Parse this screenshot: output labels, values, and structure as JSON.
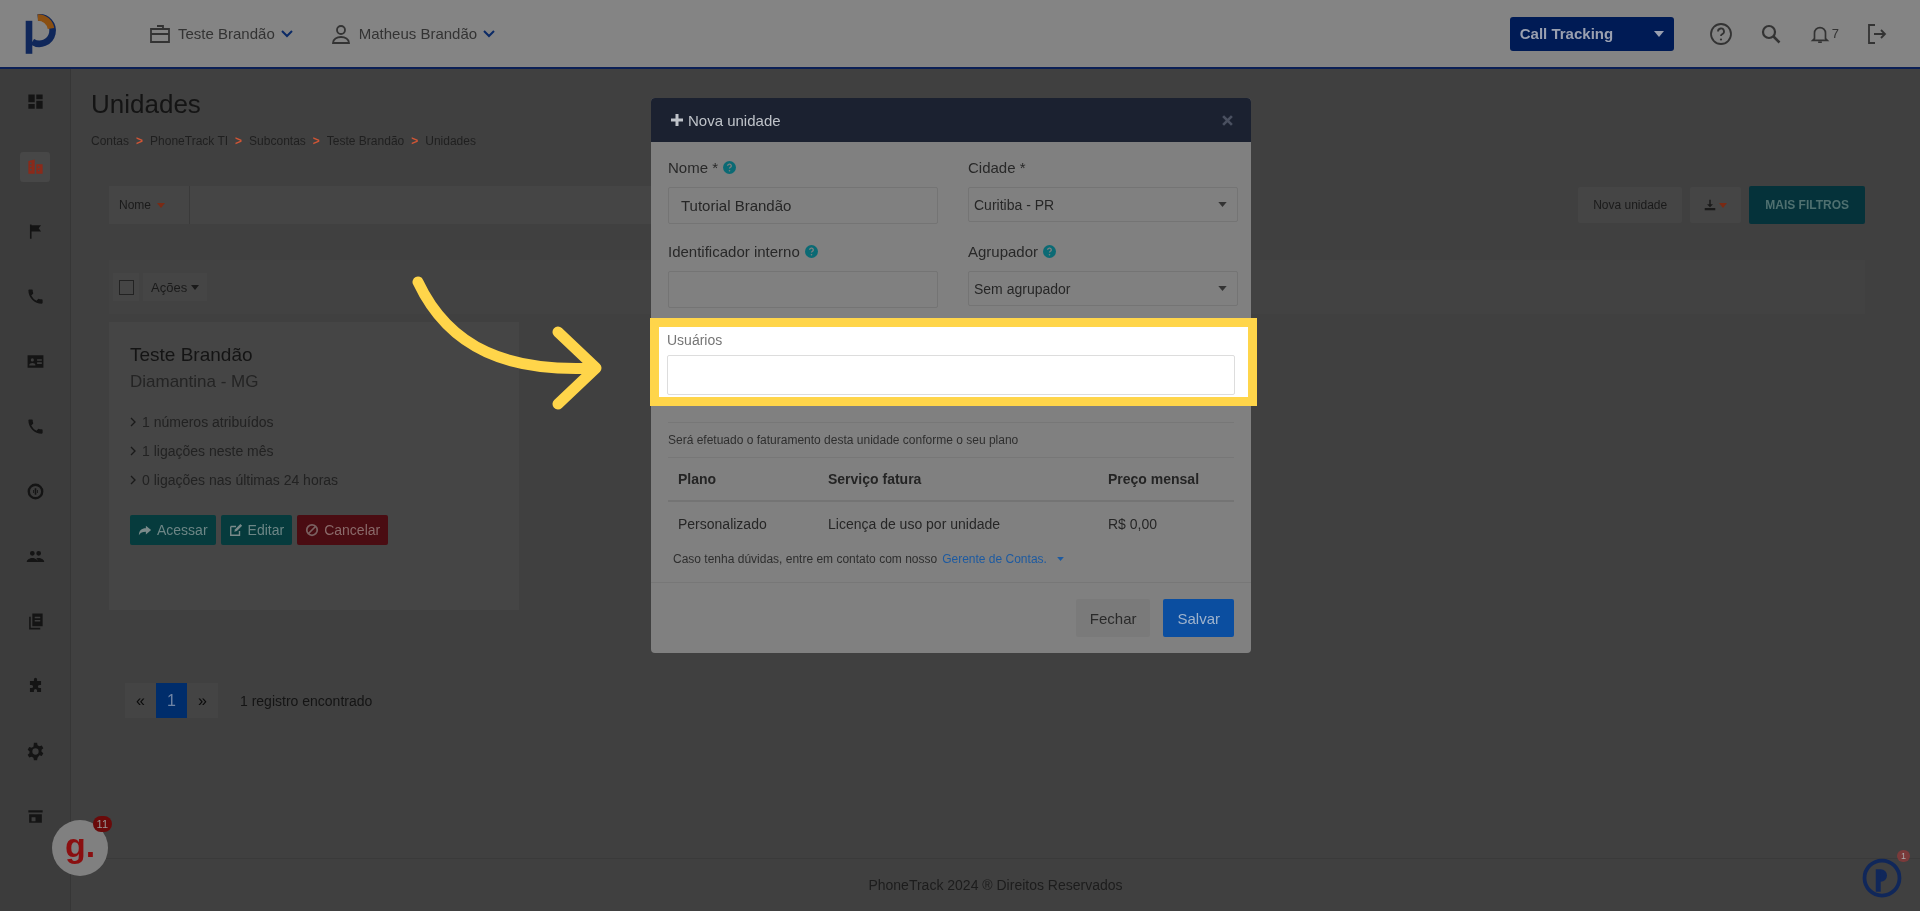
{
  "topbar": {
    "account": "Teste Brandão",
    "user": "Matheus Brandão",
    "product_select": "Call Tracking",
    "notifications_count": "7"
  },
  "sidebar": {
    "items": [
      {
        "selected": false
      },
      {
        "selected": true
      },
      {
        "selected": false
      },
      {
        "selected": false
      },
      {
        "selected": false
      },
      {
        "selected": false
      },
      {
        "selected": false
      },
      {
        "selected": false
      },
      {
        "selected": false
      },
      {
        "selected": false
      },
      {
        "selected": false
      },
      {
        "selected": false
      }
    ]
  },
  "page": {
    "title": "Unidades",
    "breadcrumb": [
      {
        "label": "Contas",
        "separator": ">"
      },
      {
        "label": "PhoneTrack TI",
        "separator": ">"
      },
      {
        "label": "Subcontas",
        "separator": ">"
      },
      {
        "label": "Teste Brandão",
        "separator": ">"
      },
      {
        "label": "Unidades"
      }
    ]
  },
  "filter": {
    "field": "Nome",
    "new_button": "Nova unidade",
    "more_filters": "MAIS FILTROS"
  },
  "list_toolbar": {
    "select_all_checked": false,
    "actions": "Ações"
  },
  "unit_card": {
    "name": "Teste Brandão",
    "location": "Diamantina - MG",
    "stats": [
      "1 números atribuídos",
      "1 ligações neste mês",
      "0 ligações nas últimas 24 horas"
    ],
    "buttons": [
      {
        "label": "Acessar",
        "kind": "access"
      },
      {
        "label": "Editar",
        "kind": "edit"
      },
      {
        "label": "Cancelar",
        "kind": "cancel"
      }
    ]
  },
  "pagination": {
    "prev": "«",
    "pages": [
      {
        "label": "1",
        "selected": true
      }
    ],
    "next": "»",
    "summary": "1 registro encontrado"
  },
  "modal": {
    "title": "Nova unidade",
    "fields": [
      {
        "label": "Nome *",
        "help": true,
        "kind": "input",
        "value": "Tutorial Brandão"
      },
      {
        "label": "Cidade *",
        "help": false,
        "kind": "select",
        "value": "Curitiba - PR"
      },
      {
        "label": "Identificador interno",
        "help": true,
        "kind": "input"
      },
      {
        "label": "Agrupador",
        "help": true,
        "kind": "select",
        "value": "Sem agrupador"
      }
    ],
    "users_label": "Usuários",
    "billing_note": "Será efetuado o faturamento desta unidade conforme o seu plano",
    "table": {
      "columns": [
        "Plano",
        "Serviço fatura",
        "Preço mensal"
      ],
      "rows": [
        [
          "Personalizado",
          "Licença de uso por unidade",
          "R$ 0,00"
        ]
      ]
    },
    "contact": {
      "text": "Caso tenha dúvidas, entre em contato com nosso",
      "link": "Gerente de Contas."
    },
    "buttons": [
      {
        "label": "Fechar",
        "kind": "secondary"
      },
      {
        "label": "Salvar",
        "kind": "primary"
      }
    ]
  },
  "footer": "PhoneTrack 2024 ® Direitos Reservados",
  "widgets": {
    "chat_label": "g.",
    "chat_badge": "11",
    "support_badge": "1"
  }
}
